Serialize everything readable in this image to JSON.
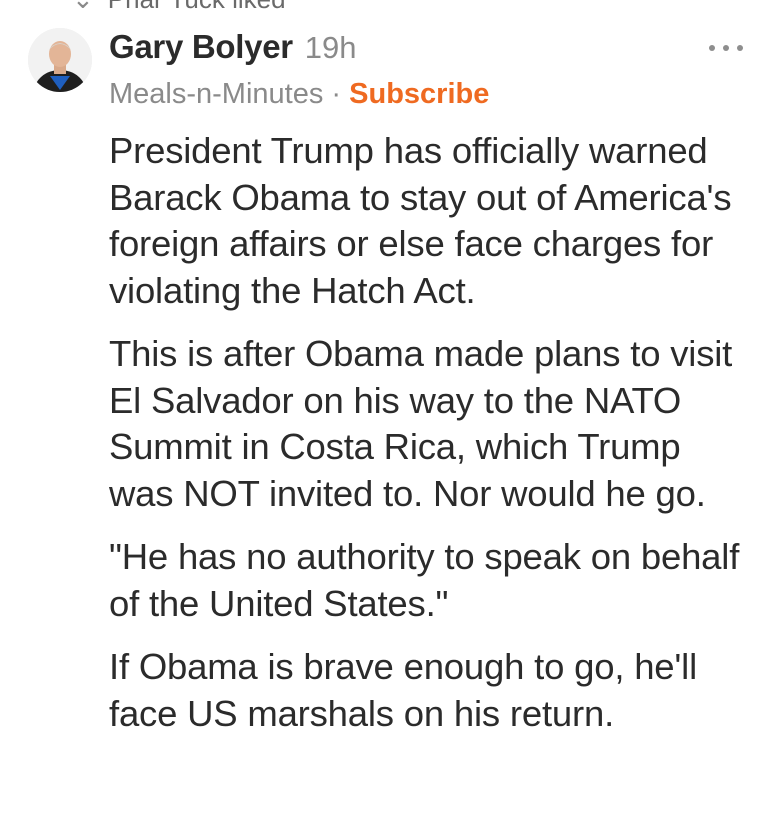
{
  "context": {
    "liked_text": "Phar Tuck liked"
  },
  "post": {
    "author": "Gary Bolyer",
    "time": "19h",
    "publication": "Meals-n-Minutes",
    "separator": "·",
    "subscribe_label": "Subscribe",
    "more_icon": "ellipsis-icon",
    "paragraphs": [
      "President Trump has officially warned Barack Obama to stay out of America's foreign affairs or else face charges for violating the Hatch Act.",
      "This is after Obama made plans to visit El Salvador on his way to the NATO Summit in Costa Rica, which Trump was NOT invited to. Nor would he go.",
      "\"He has no authority to speak on behalf of the United States.\"",
      "If Obama is brave enough to go, he'll face US marshals on his return."
    ]
  },
  "colors": {
    "accent": "#ef6a21",
    "text": "#2b2b2b",
    "muted": "#8a8a8a"
  }
}
